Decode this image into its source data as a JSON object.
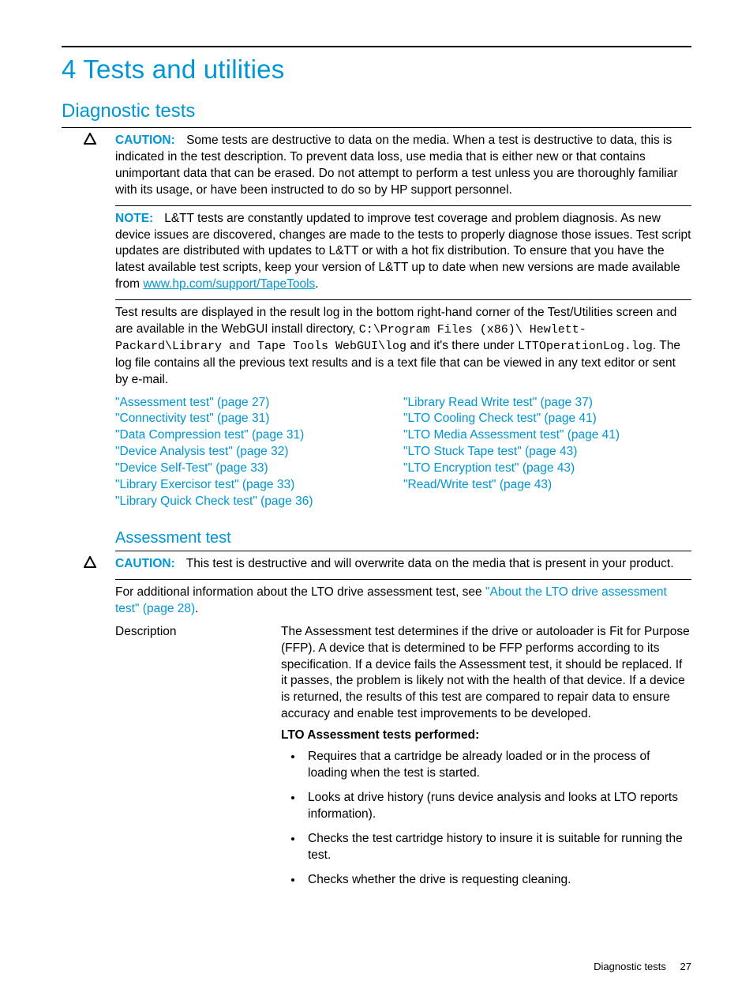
{
  "chapter_title": "4 Tests and utilities",
  "section_title": "Diagnostic tests",
  "caution1": {
    "label": "CAUTION:",
    "text": "Some tests are destructive to data on the media. When a test is destructive to data, this is indicated in the test description. To prevent data loss, use media that is either new or that contains unimportant data that can be erased. Do not attempt to perform a test unless you are thoroughly familiar with its usage, or have been instructed to do so by HP support personnel."
  },
  "note1": {
    "label": "NOTE:",
    "pre": "L&TT tests are constantly updated to improve test coverage and problem diagnosis. As new device issues are discovered, changes are made to the tests to properly diagnose those issues. Test script updates are distributed with updates to L&TT or with a hot fix distribution. To ensure that you have the latest available test scripts, keep your version of L&TT up to date when new versions are made available from ",
    "link_text": "www.hp.com/support/TapeTools",
    "post": "."
  },
  "results_para": {
    "p1a": "Test results are displayed in the result log in the bottom right-hand corner of the Test/Utilities screen and are available in the WebGUI install directory, ",
    "mono1": "C:\\Program Files (x86)\\ Hewlett-Packard\\Library and Tape Tools WebGUI\\log",
    "mid": " and it's there under ",
    "mono2": "LTTOperationLog.log",
    "p1b": ". The log file contains all the previous text results and is a text file that can be viewed in any text editor or sent by e-mail."
  },
  "toc_left": [
    "\"Assessment test\" (page 27)",
    "\"Connectivity test\" (page 31)",
    "\"Data Compression test\" (page 31)",
    "\"Device Analysis test\" (page 32)",
    "\"Device Self-Test\" (page 33)",
    "\"Library Exercisor test\" (page 33)",
    "\"Library Quick Check test\" (page 36)"
  ],
  "toc_right": [
    "\"Library Read Write test\" (page 37)",
    "\"LTO Cooling Check test\" (page 41)",
    "\"LTO Media Assessment test\" (page 41)",
    "\"LTO Stuck Tape test\" (page 43)",
    "\"LTO Encryption test\" (page 43)",
    "\"Read/Write test\" (page 43)"
  ],
  "subsection_title": "Assessment test",
  "caution2": {
    "label": "CAUTION:",
    "text": "This test is destructive and will overwrite data on the media that is present in your product."
  },
  "addl_info": {
    "pre": "For additional information about the LTO drive assessment test, see ",
    "link": "\"About the LTO drive assessment test\" (page 28)",
    "post": "."
  },
  "description": {
    "label": "Description",
    "body": "The Assessment test determines if the drive or autoloader is Fit for Purpose (FFP). A device that is determined to be FFP performs according to its specification. If a device fails the Assessment test, it should be replaced. If it passes, the problem is likely not with the health of that device. If a device is returned, the results of this test are compared to repair data to ensure accuracy and enable test improvements to be developed.",
    "subheading": "LTO Assessment tests performed:",
    "bullets": [
      "Requires that a cartridge be already loaded or in the process of loading when the test is started.",
      "Looks at drive history (runs device analysis and looks at LTO reports information).",
      "Checks the test cartridge history to insure it is suitable for running the test.",
      "Checks whether the drive is requesting cleaning."
    ]
  },
  "footer": {
    "section": "Diagnostic tests",
    "page": "27"
  }
}
